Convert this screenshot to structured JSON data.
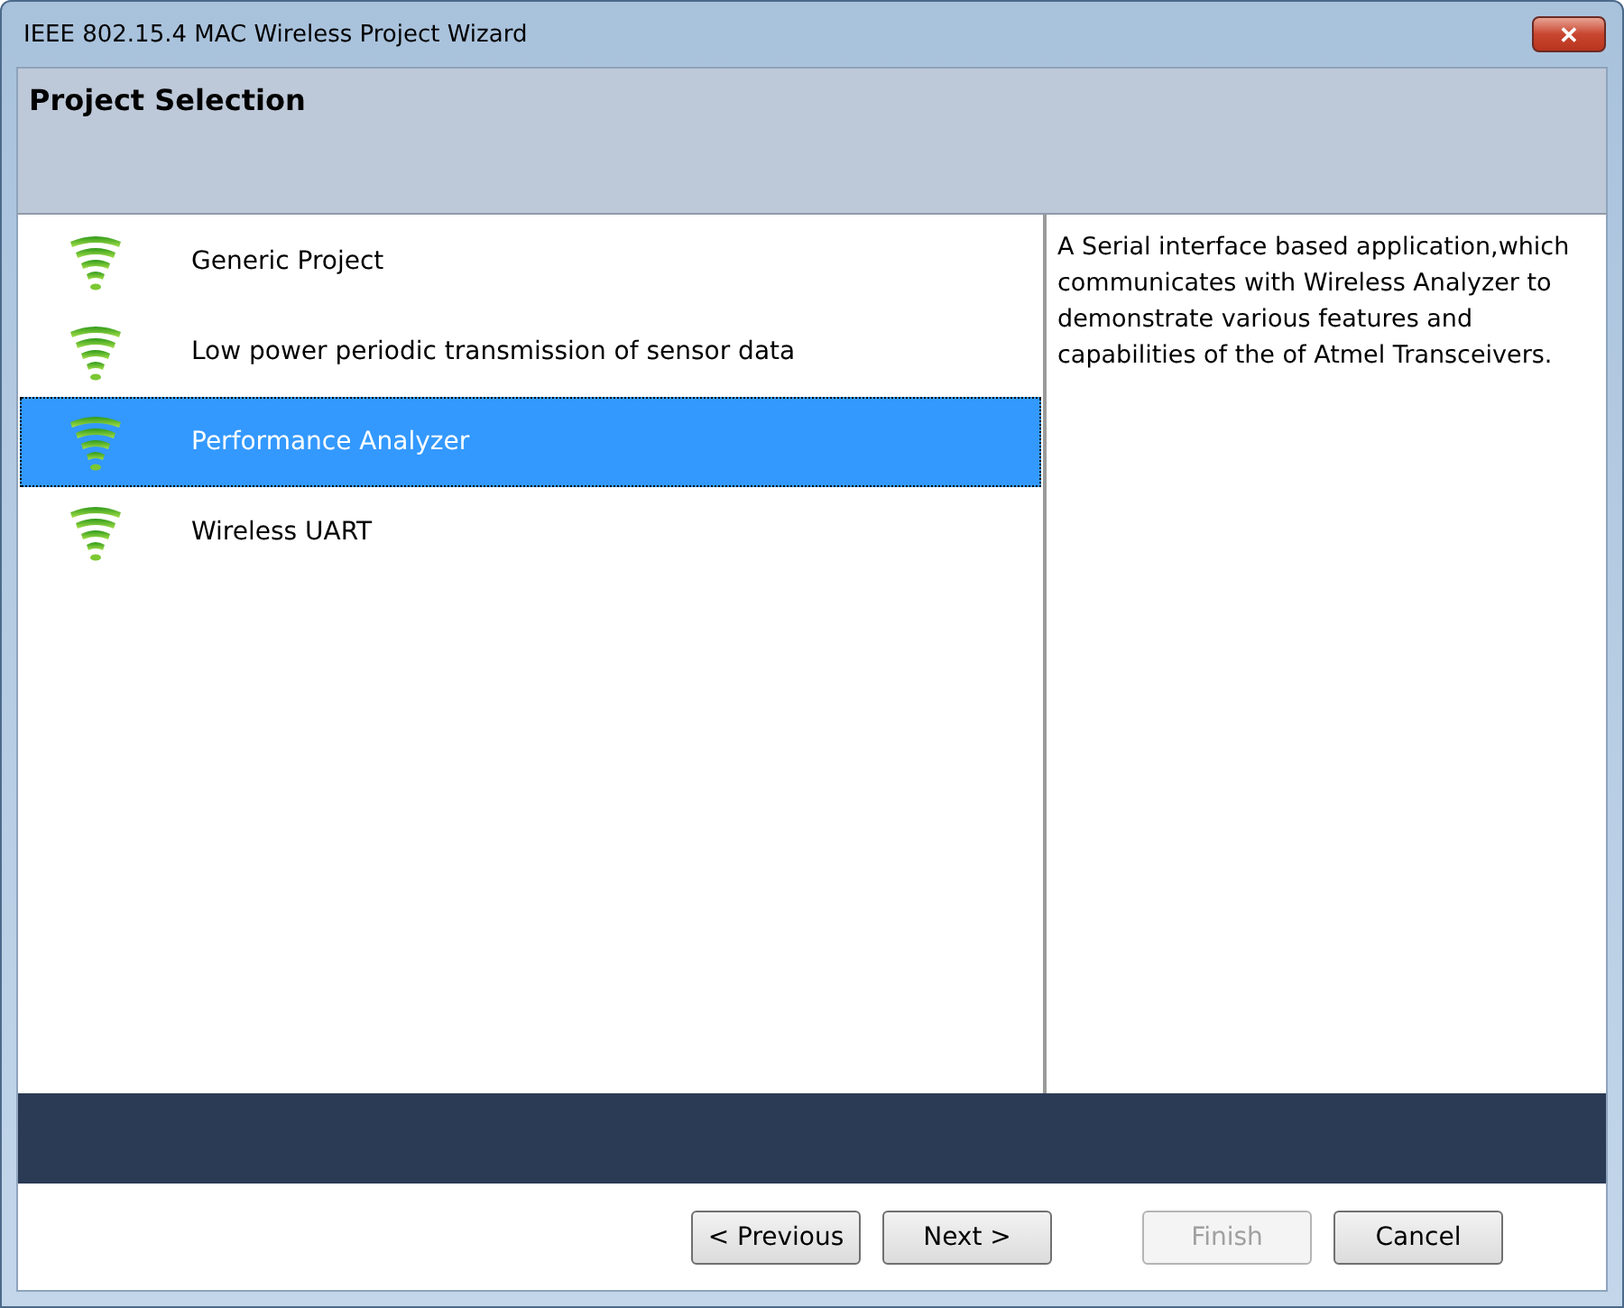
{
  "window": {
    "title": "IEEE 802.15.4 MAC Wireless Project Wizard",
    "close_label": "✕"
  },
  "header": {
    "title": "Project Selection"
  },
  "projects": [
    {
      "label": "Generic Project",
      "selected": false
    },
    {
      "label": "Low power periodic transmission of sensor data",
      "selected": false
    },
    {
      "label": "Performance Analyzer",
      "selected": true
    },
    {
      "label": "Wireless UART",
      "selected": false
    }
  ],
  "description": "A Serial interface based application,which communicates with Wireless Analyzer to demonstrate various features and capabilities of the of Atmel Transceivers.",
  "buttons": [
    {
      "label": "< Previous",
      "disabled": false
    },
    {
      "label": "Next >",
      "disabled": false
    },
    {
      "label": "Finish",
      "disabled": true
    },
    {
      "label": "Cancel",
      "disabled": false
    }
  ]
}
